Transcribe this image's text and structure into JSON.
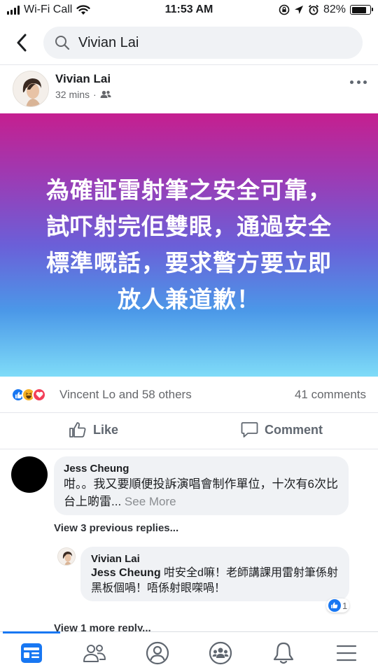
{
  "status_bar": {
    "carrier": "Wi-Fi Call",
    "time": "11:53 AM",
    "battery": "82%",
    "battery_level": 0.82,
    "icons": [
      "signal-icon",
      "wifi-icon",
      "screen-lock-icon",
      "location-arrow-icon",
      "alarm-icon",
      "battery-icon"
    ]
  },
  "search": {
    "query": "Vivian Lai",
    "icons": [
      "back-chevron-icon",
      "search-icon"
    ]
  },
  "post": {
    "author": "Vivian Lai",
    "time": "32 mins",
    "separator": "·",
    "audience_icon": "friends-icon",
    "body": "為確証雷射筆之安全可靠，試吓射完佢雙眼，通過安全標準嘅話，要求警方要立即放人兼道歉！",
    "background_gradient": [
      "#c51f8f",
      "#9b3cb5",
      "#6b5fd8",
      "#4b98e8",
      "#7fdcf8"
    ]
  },
  "reactions": {
    "icons": [
      "like-reaction-icon",
      "haha-reaction-icon",
      "love-reaction-icon"
    ],
    "text": "Vincent Lo and 58 others",
    "comments": "41 comments"
  },
  "actions": {
    "like": "Like",
    "comment": "Comment"
  },
  "comments": {
    "first": {
      "author": "Jess Cheung",
      "text": "咁。。我又要順便投訴演唱會制作單位，十次有6次比台上啲雷...",
      "see_more": "See More"
    },
    "view_previous": "View 3 previous replies...",
    "reply": {
      "author": "Vivian Lai",
      "mention": "Jess Cheung",
      "text": " 咁安全d嘛！老師講課用雷射筆係射黑板個喎！唔係射眼㗎喎！",
      "like_count": "1"
    },
    "view_more": "View 1 more reply..."
  },
  "bottom_nav": {
    "items": [
      "news-feed-icon",
      "friends-icon",
      "profile-icon",
      "groups-icon",
      "notifications-bell-icon",
      "menu-icon"
    ],
    "active": "news-feed-icon",
    "accent": "#1877f2"
  }
}
